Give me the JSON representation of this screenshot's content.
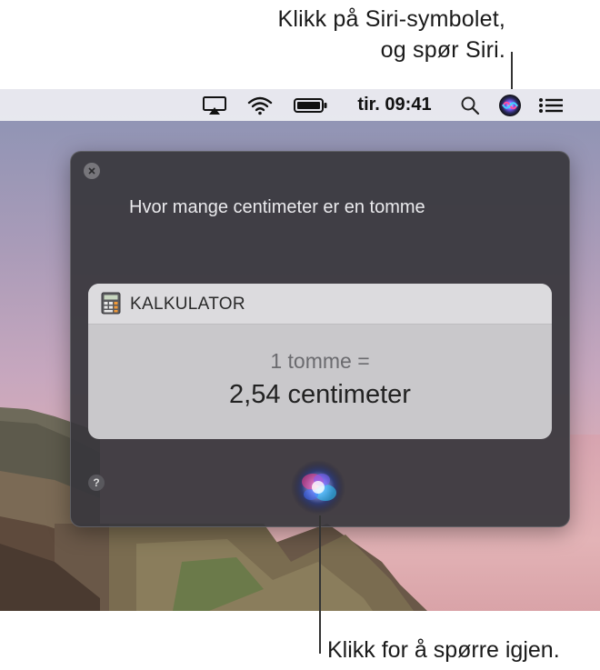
{
  "callouts": {
    "top_line1": "Klikk på Siri-symbolet,",
    "top_line2": "og spør Siri.",
    "bottom": "Klikk for å spørre igjen."
  },
  "menubar": {
    "clock": "tir. 09:41",
    "icons": [
      "airplay-icon",
      "wifi-icon",
      "battery-icon",
      "spotlight-search-icon",
      "siri-icon",
      "notification-center-icon"
    ]
  },
  "siri": {
    "question": "Hvor mange centimeter er en tomme",
    "card": {
      "app_name": "KALKULATOR",
      "result_line1": "1 tomme =",
      "result_line2": "2,54 centimeter"
    },
    "help_label": "?"
  }
}
